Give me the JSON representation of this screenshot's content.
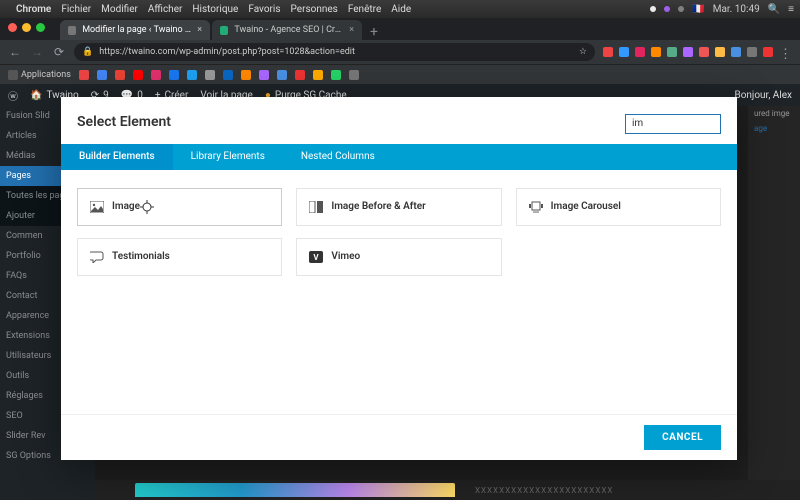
{
  "mac_menu": {
    "app": "Chrome",
    "items": [
      "Fichier",
      "Modifier",
      "Afficher",
      "Historique",
      "Favoris",
      "Personnes",
      "Fenêtre",
      "Aide"
    ],
    "clock": "Mar. 10:49",
    "flag": "🇫🇷"
  },
  "chrome": {
    "tabs": [
      {
        "title": "Modifier la page ‹ Twaino — W",
        "active": true
      },
      {
        "title": "Twaino - Agence SEO | Croiss",
        "active": false
      }
    ],
    "url": "https://twaino.com/wp-admin/post.php?post=1028&action=edit",
    "bookmarks_label": "Applications"
  },
  "wp_bar": {
    "site": "Twaino",
    "updates": "9",
    "comments": "0",
    "new": "Créer",
    "view": "Voir la page",
    "cache": "Purge SG Cache",
    "greeting": "Bonjour, Alex"
  },
  "wp_side": {
    "items": [
      "Fusion Slid",
      "Articles",
      "Médias",
      "Pages",
      "Toutes les pag",
      "Ajouter",
      "Commen",
      "Portfolio",
      "FAQs",
      "Contact",
      "Apparence",
      "Extensions",
      "Utilisateurs",
      "Outils",
      "Réglages",
      "SEO",
      "Slider Rev",
      "SG Options"
    ],
    "active_index": 3
  },
  "modal": {
    "title": "Select Element",
    "search_value": "im",
    "tabs": [
      "Builder Elements",
      "Library Elements",
      "Nested Columns"
    ],
    "active_tab": 0,
    "elements": [
      {
        "icon": "image",
        "label": "Image"
      },
      {
        "icon": "compare",
        "label": "Image Before & After"
      },
      {
        "icon": "carousel",
        "label": "Image Carousel"
      },
      {
        "icon": "quote",
        "label": "Testimonials"
      },
      {
        "icon": "vimeo",
        "label": "Vimeo"
      }
    ],
    "cancel": "CANCEL"
  },
  "footer_placeholder": "XXXXXXXXXXXXXXXXXXXXXXX"
}
